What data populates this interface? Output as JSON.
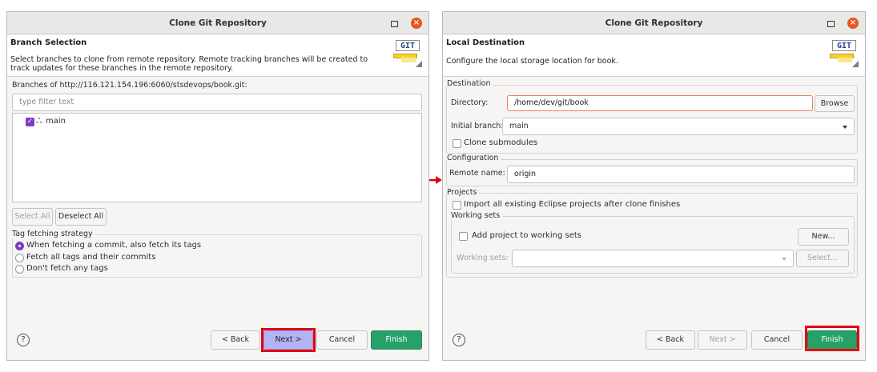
{
  "dialog1": {
    "title": "Clone Git Repository",
    "heading": "Branch Selection",
    "description": "Select branches to clone from remote repository. Remote tracking branches will be created to track updates for these branches in the remote repository.",
    "branches_label": "Branches of http://116.121.154.196:6060/stsdevops/book.git:",
    "filter_placeholder": "type filter text",
    "branch_items": [
      {
        "label": "main",
        "checked": true
      }
    ],
    "select_all": "Select All",
    "deselect_all": "Deselect All",
    "tag_group_title": "Tag fetching strategy",
    "tag_options": [
      {
        "label": "When fetching a commit, also fetch its tags",
        "selected": true
      },
      {
        "label": "Fetch all tags and their commits",
        "selected": false
      },
      {
        "label": "Don't fetch any tags",
        "selected": false
      }
    ],
    "buttons": {
      "back": "< Back",
      "next": "Next >",
      "cancel": "Cancel",
      "finish": "Finish"
    }
  },
  "dialog2": {
    "title": "Clone Git Repository",
    "heading": "Local Destination",
    "description": "Configure the local storage location for book.",
    "destination_group": "Destination",
    "directory_label": "Directory:",
    "directory_value": "/home/dev/git/book",
    "browse": "Browse",
    "initial_branch_label": "Initial branch:",
    "initial_branch_value": "main",
    "clone_submodules": "Clone submodules",
    "configuration_group": "Configuration",
    "remote_name_label": "Remote name:",
    "remote_name_value": "origin",
    "projects_group": "Projects",
    "import_projects": "Import all existing Eclipse projects after clone finishes",
    "working_sets_group": "Working sets",
    "add_to_working_sets": "Add project to working sets",
    "new_button": "New...",
    "working_sets_label": "Working sets:",
    "select_button": "Select...",
    "buttons": {
      "back": "< Back",
      "next": "Next >",
      "cancel": "Cancel",
      "finish": "Finish"
    }
  },
  "icons": {
    "help": "?",
    "close": "×",
    "check": "✓",
    "branch": "ஃ"
  },
  "colors": {
    "accent": "#7a3fbf",
    "finish": "#26a269",
    "highlight": "#e3000f",
    "close": "#e95420"
  }
}
